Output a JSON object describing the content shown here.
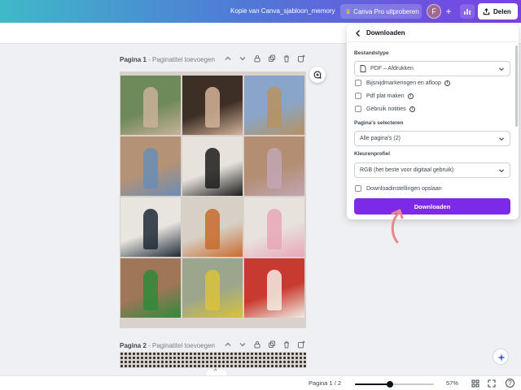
{
  "header": {
    "doc_title": "Kopie van Canva_sjabloon_memory",
    "pro_label": "Canva Pro uitproberen",
    "avatar_initial": "F",
    "plus_symbol": "+",
    "share_label": "Delen"
  },
  "pages": [
    {
      "name": "Pagina 1",
      "title": "Paginatitel toevoegen",
      "separator": " - "
    },
    {
      "name": "Pagina 2",
      "title": "Paginatitel toevoegen",
      "separator": " - "
    }
  ],
  "photos": [
    {
      "colors": [
        "#6f8a5a",
        "#c9b19a"
      ]
    },
    {
      "colors": [
        "#3d2f26",
        "#d4b39a"
      ]
    },
    {
      "colors": [
        "#8aa5c7",
        "#b7925f"
      ]
    },
    {
      "colors": [
        "#b49276",
        "#6a8db5"
      ]
    },
    {
      "colors": [
        "#e7e2db",
        "#1c1c1c"
      ]
    },
    {
      "colors": [
        "#b38e73",
        "#c2a6b5"
      ]
    },
    {
      "colors": [
        "#e8e4de",
        "#1f2a37"
      ]
    },
    {
      "colors": [
        "#d7d0c6",
        "#c96b2e"
      ]
    },
    {
      "colors": [
        "#e7e2dc",
        "#e8a6b6"
      ]
    },
    {
      "colors": [
        "#9f7658",
        "#2f8a3a"
      ]
    },
    {
      "colors": [
        "#9ca68c",
        "#d9c23b"
      ]
    },
    {
      "colors": [
        "#c83a2f",
        "#f2ede4"
      ]
    }
  ],
  "download_panel": {
    "title": "Downloaden",
    "file_type_label": "Bestandstype",
    "file_type_value": "PDF – Afdrukken",
    "options": [
      {
        "label": "Bijsnijdmarkeringen en afloop",
        "checked": false,
        "info": "i"
      },
      {
        "label": "Pdf plat maken",
        "checked": false,
        "info": "i"
      },
      {
        "label": "Gebruik notities",
        "checked": false,
        "info": "i"
      }
    ],
    "pages_label": "Pagina's selecteren",
    "pages_value": "Alle pagina's (2)",
    "color_profile_label": "Kleurenprofiel",
    "color_profile_value": "RGB (het beste voor digitaal gebruik)",
    "save_settings_label": "Downloadinstellingen opslaan",
    "save_settings_checked": false,
    "download_button": "Downloaden"
  },
  "footer": {
    "page_indicator": "Pagina 1 / 2",
    "zoom_level": "57%",
    "zoom_fraction": 0.44,
    "notch_glyph": "^",
    "help_label": "?"
  },
  "colors": {
    "accent": "#7d2ae8",
    "arrow": "#e8868f"
  }
}
